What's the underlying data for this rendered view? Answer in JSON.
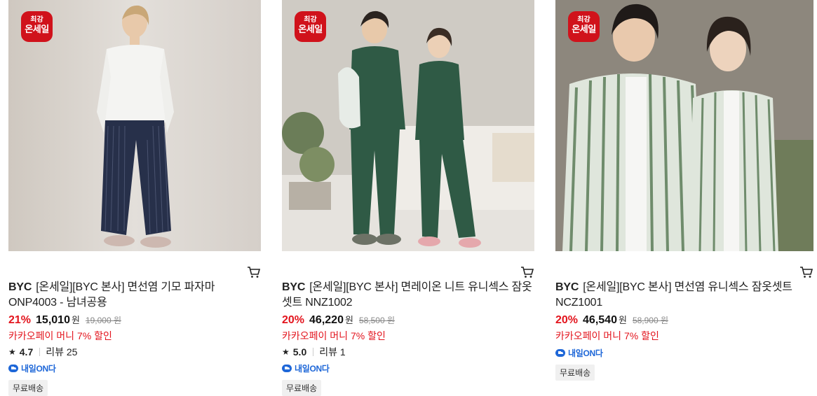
{
  "products": [
    {
      "badge_line1": "최강",
      "badge_line2": "온세일",
      "brand": "BYC",
      "name": "[온세일][BYC 본사] 면선염 기모 파자마 ONP4003 - 남녀공용",
      "discount_rate": "21%",
      "price": "15,010",
      "currency": "원",
      "original_price": "19,000 원",
      "promo": "카카오페이 머니 7% 할인",
      "rating": "4.7",
      "review_label": "리뷰 25",
      "delivery_label": "내일ON다",
      "tag": "무료배송"
    },
    {
      "badge_line1": "최강",
      "badge_line2": "온세일",
      "brand": "BYC",
      "name": "[온세일][BYC 본사] 면레이온 니트 유니섹스 잠옷셋트 NNZ1002",
      "discount_rate": "20%",
      "price": "46,220",
      "currency": "원",
      "original_price": "58,500 원",
      "promo": "카카오페이 머니 7% 할인",
      "rating": "5.0",
      "review_label": "리뷰 1",
      "delivery_label": "내일ON다",
      "tag": "무료배송"
    },
    {
      "badge_line1": "최강",
      "badge_line2": "온세일",
      "brand": "BYC",
      "name": "[온세일][BYC 본사] 면선염 유니섹스 잠옷셋트 NCZ1001",
      "discount_rate": "20%",
      "price": "46,540",
      "currency": "원",
      "original_price": "58,900 원",
      "promo": "카카오페이 머니 7% 할인",
      "delivery_label": "내일ON다",
      "tag": "무료배송"
    }
  ],
  "colors": {
    "badge_red": "#d0121b",
    "discount_red": "#e3141d",
    "delivery_blue": "#1e67d8"
  }
}
